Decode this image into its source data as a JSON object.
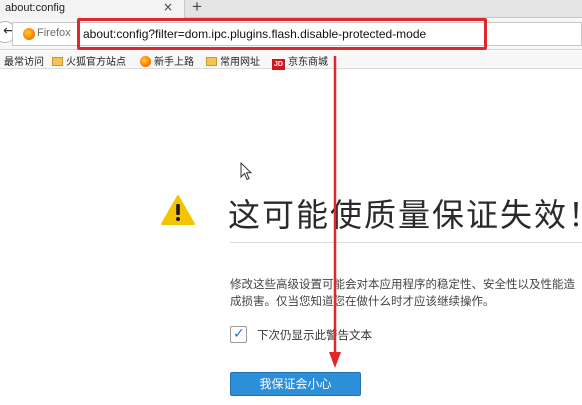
{
  "tab": {
    "title": "about:config",
    "close": "×",
    "new_tab": "+"
  },
  "navbar": {
    "identity_label": "Firefox",
    "url": "about:config?filter=dom.ipc.plugins.flash.disable-protected-mode"
  },
  "bookmarks": [
    {
      "label": "最常访问",
      "icon": "none"
    },
    {
      "label": "火狐官方站点",
      "icon": "folder-icon"
    },
    {
      "label": "新手上路",
      "icon": "firefox-icon"
    },
    {
      "label": "常用网址",
      "icon": "folder-icon"
    },
    {
      "label": "京东商城",
      "icon": "jd-icon",
      "icon_text": "JD"
    }
  ],
  "warning": {
    "title": "这可能使质量保证失效！",
    "description": "修改这些高级设置可能会对本应用程序的稳定性、安全性以及性能造成损害。仅当您知道您在做什么时才应该继续操作。",
    "checkbox_label": "下次仍显示此警告文本",
    "checkbox_checked": true,
    "accept_button": "我保证会小心"
  },
  "colors": {
    "annotation_red": "#e0272b",
    "button_blue": "#2e8fd9",
    "warning_yellow": "#f5c400"
  }
}
